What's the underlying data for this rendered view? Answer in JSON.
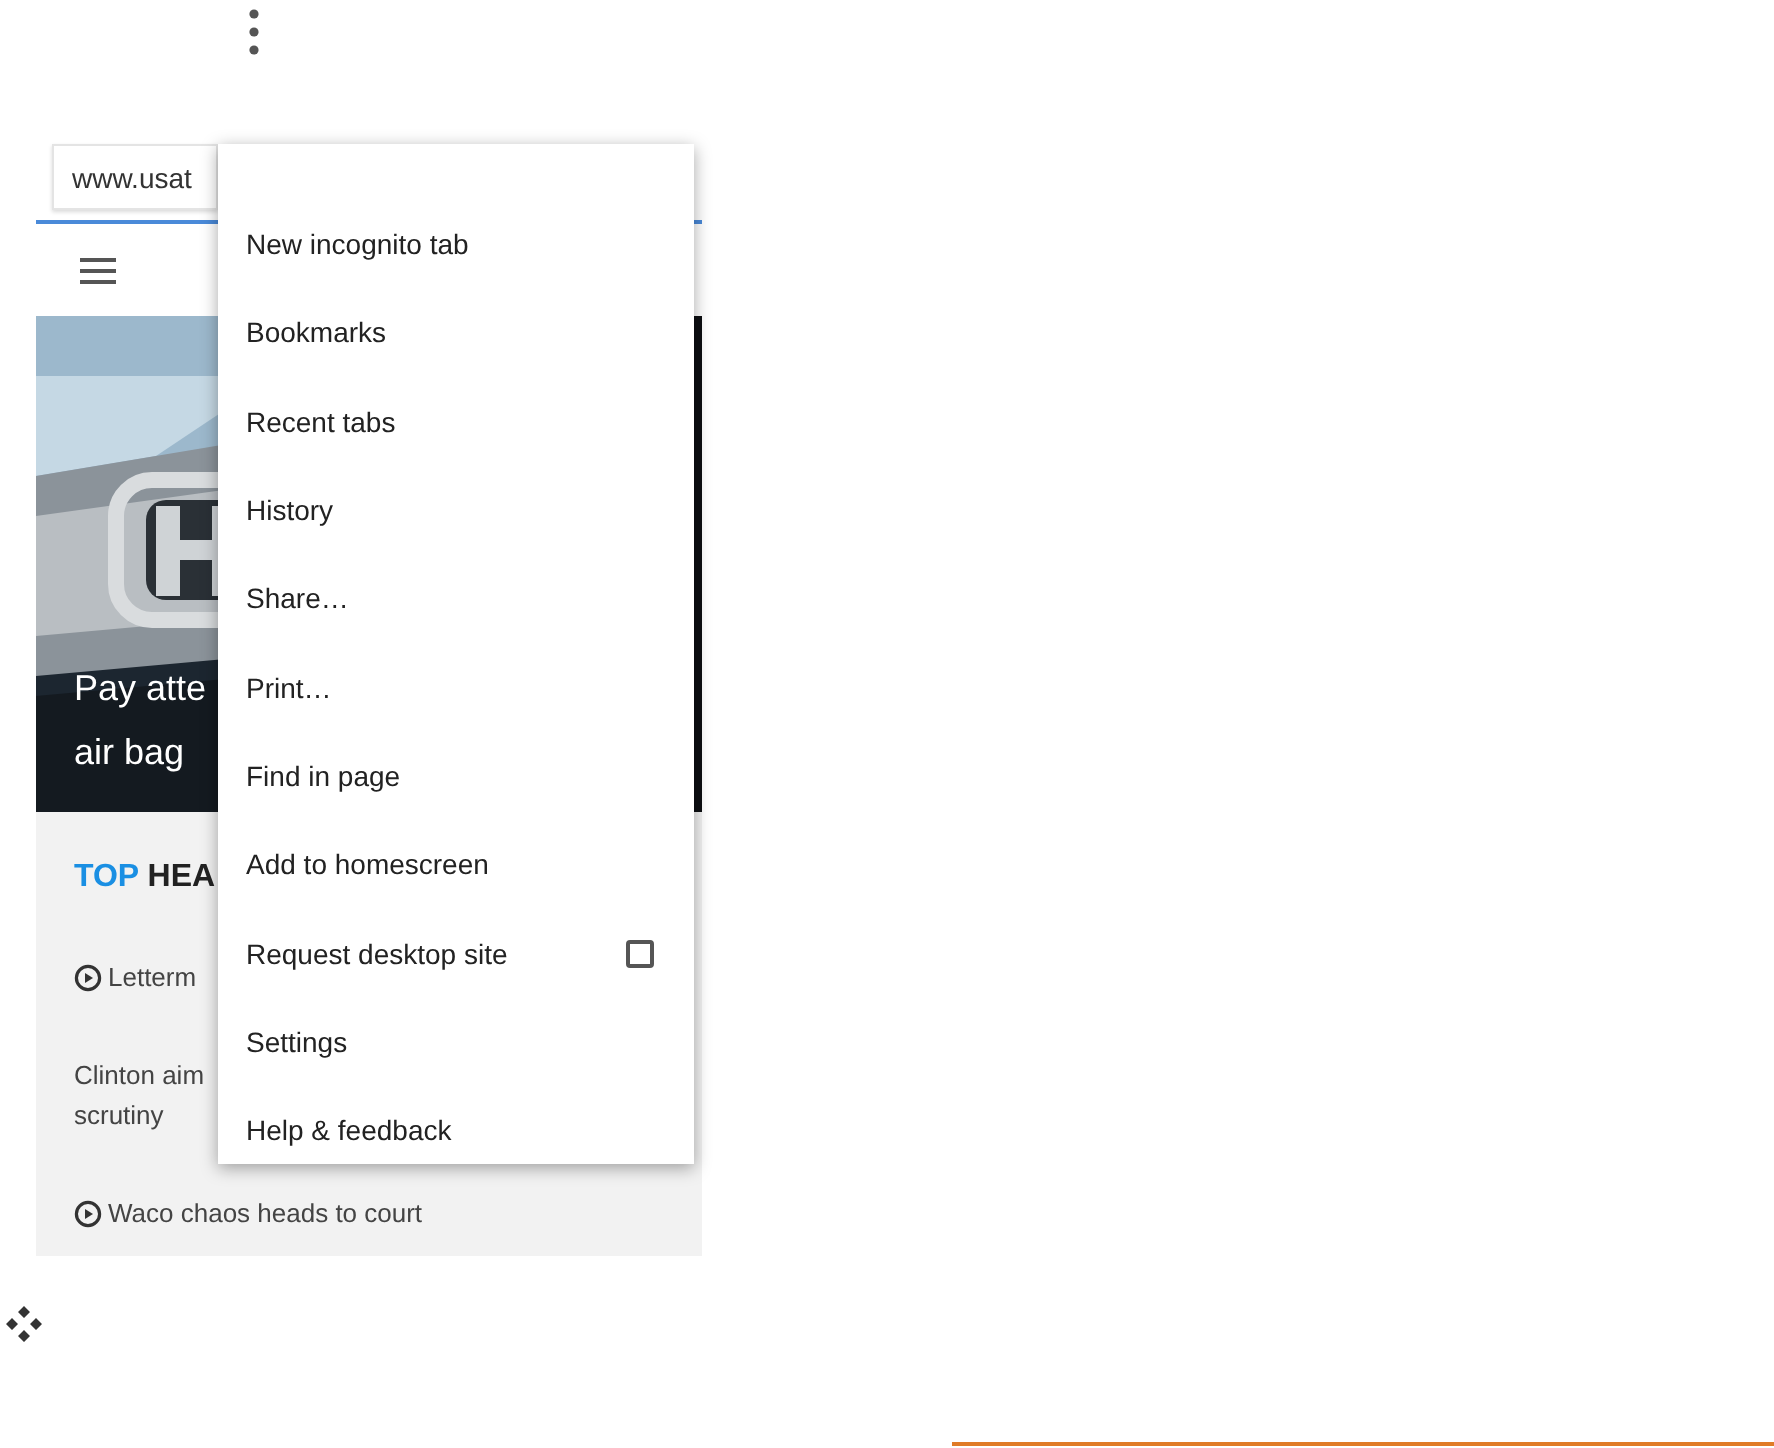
{
  "address_bar": {
    "value": "www.usat"
  },
  "story": {
    "caption_lines": [
      "Pay atte",
      "air bag"
    ]
  },
  "section": {
    "title_accent": "TOP",
    "title_rest": "HEA"
  },
  "headlines": [
    {
      "kind": "video",
      "text": "Letterm"
    },
    {
      "kind": "plain",
      "text": "Clinton aim\nscrutiny"
    },
    {
      "kind": "video",
      "text": "Waco chaos heads to court"
    }
  ],
  "menu": {
    "items": [
      {
        "kind": "item",
        "label": "New incognito tab"
      },
      {
        "kind": "item",
        "label": "Bookmarks"
      },
      {
        "kind": "item",
        "label": "Recent tabs"
      },
      {
        "kind": "item",
        "label": "History"
      },
      {
        "kind": "item",
        "label": "Share…"
      },
      {
        "kind": "item",
        "label": "Print…"
      },
      {
        "kind": "item",
        "label": "Find in page"
      },
      {
        "kind": "item",
        "label": "Add to homescreen"
      },
      {
        "kind": "checkbox",
        "label": "Request desktop site",
        "checked": false
      },
      {
        "kind": "item",
        "label": "Settings"
      },
      {
        "kind": "item",
        "label": "Help & feedback"
      }
    ]
  }
}
